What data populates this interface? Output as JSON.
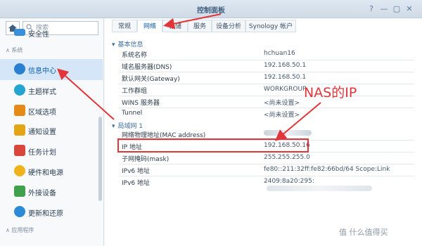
{
  "window": {
    "title": "控制面板"
  },
  "sidebar": {
    "search_placeholder": "搜索",
    "partial_top_item": "安全性",
    "section_system": "系统",
    "items": [
      {
        "label": "信息中心",
        "icon": "info-icon",
        "color": "#2a7fd1"
      },
      {
        "label": "主题样式",
        "icon": "palette-icon",
        "color": "#23a4d1"
      },
      {
        "label": "区域选项",
        "icon": "region-icon",
        "color": "#e68a17"
      },
      {
        "label": "通知设置",
        "icon": "bell-icon",
        "color": "#e4a416"
      },
      {
        "label": "任务计划",
        "icon": "calendar-icon",
        "color": "#d8463c"
      },
      {
        "label": "硬件和电源",
        "icon": "bulb-icon",
        "color": "#f0b21b"
      },
      {
        "label": "外接设备",
        "icon": "device-icon",
        "color": "#3fa14b"
      },
      {
        "label": "更新和还原",
        "icon": "update-icon",
        "color": "#2d8bd6"
      }
    ],
    "section_apps": "应用程序"
  },
  "tabs": [
    "常规",
    "网络",
    "存储",
    "服务",
    "设备分析",
    "Synology 帐户"
  ],
  "active_tab": "网络",
  "basic_section": {
    "heading": "基本信息",
    "rows": [
      {
        "label": "系统名称",
        "value": "hchuan16"
      },
      {
        "label": "域名服务器(DNS)",
        "value": "192.168.50.1"
      },
      {
        "label": "默认网关(Gateway)",
        "value": "192.168.50.1"
      },
      {
        "label": "工作群组",
        "value": "WORKGROUP"
      },
      {
        "label": "WINS 服务器",
        "value": "<尚未设置>"
      },
      {
        "label": "Tunnel",
        "value": "<尚未设置>"
      }
    ]
  },
  "lan_section": {
    "heading": "局域网 1",
    "rows": [
      {
        "label": "网络物理地址(MAC address)",
        "value": ""
      },
      {
        "label": "IP 地址",
        "value": "192.168.50.16"
      },
      {
        "label": "子网掩码(mask)",
        "value": "255.255.255.0"
      },
      {
        "label": "IPv6 地址",
        "value": "fe80::211:32ff:fe82:66bd/64 Scope:Link"
      },
      {
        "label": "IPv6 地址",
        "value": "2409:8a20:295:"
      }
    ]
  },
  "annotation": "NAS的IP",
  "watermark": "值 什么值得买",
  "colors": {
    "accent": "#0e5ea8",
    "highlight": "#e2353a"
  }
}
